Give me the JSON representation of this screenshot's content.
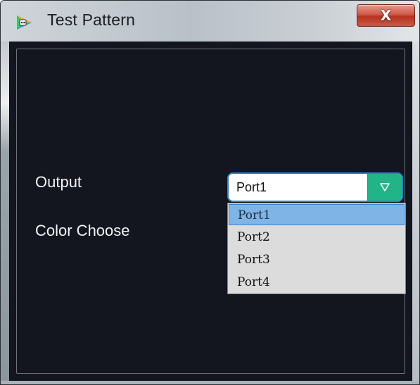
{
  "window": {
    "title": "Test Pattern",
    "close_glyph": "X"
  },
  "icons": {
    "app": "app-logo-icon",
    "close": "close-icon",
    "dropdown": "chevron-down-icon"
  },
  "form": {
    "output_label": "Output",
    "color_label": "Color Choose",
    "output_select": {
      "value": "Port1",
      "options": [
        "Port1",
        "Port2",
        "Port3",
        "Port4"
      ],
      "highlighted_index": 0
    }
  },
  "colors": {
    "background": "#13161f",
    "accent": "#21b487",
    "selection": "#7fb4e6",
    "close_button": "#c8473a"
  }
}
